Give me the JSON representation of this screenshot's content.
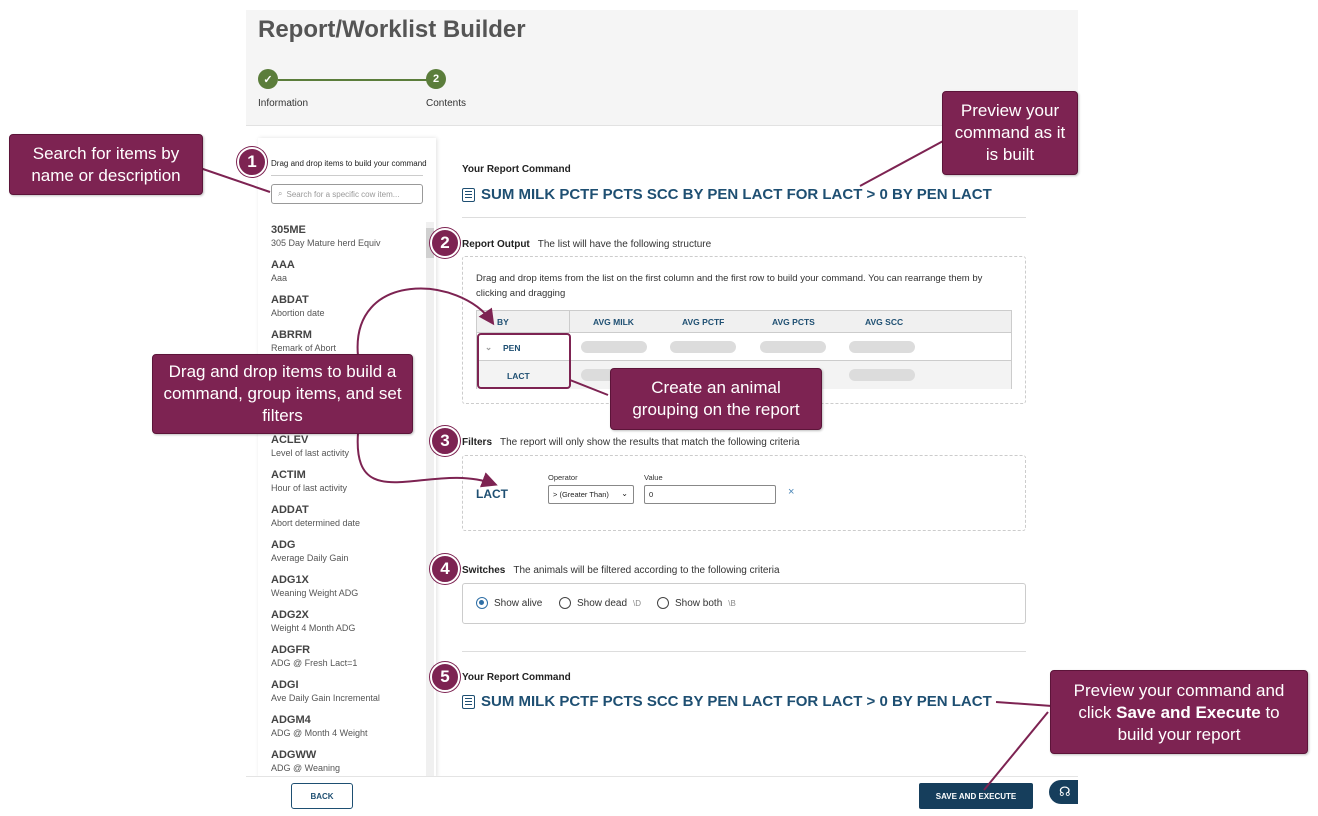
{
  "page": {
    "title": "Report/Worklist Builder",
    "steps": [
      {
        "number": "",
        "icon": "check-icon",
        "label": "Information"
      },
      {
        "number": "2",
        "label": "Contents"
      }
    ]
  },
  "sidebar": {
    "hint": "Drag and drop items to build your command",
    "search_placeholder": "Search for a specific cow item...",
    "items": [
      {
        "code": "305ME",
        "desc": "305 Day Mature herd Equiv"
      },
      {
        "code": "AAA",
        "desc": "Aaa"
      },
      {
        "code": "ABDAT",
        "desc": "Abortion date"
      },
      {
        "code": "ABRRM",
        "desc": "Remark of Abort"
      },
      {
        "code": "",
        "desc": ""
      },
      {
        "code": "",
        "desc": ""
      },
      {
        "code": "ACLEV",
        "desc": "Level of last activity"
      },
      {
        "code": "ACTIM",
        "desc": "Hour of last activity"
      },
      {
        "code": "ADDAT",
        "desc": "Abort determined date"
      },
      {
        "code": "ADG",
        "desc": "Average Daily Gain"
      },
      {
        "code": "ADG1X",
        "desc": "Weaning Weight ADG"
      },
      {
        "code": "ADG2X",
        "desc": "Weight 4 Month ADG"
      },
      {
        "code": "ADGFR",
        "desc": "ADG @ Fresh Lact=1"
      },
      {
        "code": "ADGI",
        "desc": "Ave Daily Gain Incremental"
      },
      {
        "code": "ADGM4",
        "desc": "ADG @ Month 4 Weight"
      },
      {
        "code": "ADGWW",
        "desc": "ADG @ Weaning"
      }
    ]
  },
  "command_top": {
    "title": "Your Report Command",
    "text": "SUM MILK PCTF PCTS SCC BY PEN LACT FOR LACT > 0 BY PEN LACT"
  },
  "report_output": {
    "title": "Report Output",
    "desc": "The list will have the following structure",
    "hint": "Drag and drop items from the list on the first column and the first row to build your command. You can rearrange them by clicking and dragging",
    "columns": [
      "BY",
      "AVG MILK",
      "AVG PCTF",
      "AVG PCTS",
      "AVG SCC"
    ],
    "rows": [
      "PEN",
      "LACT"
    ]
  },
  "filters": {
    "title": "Filters",
    "desc": "The report will only show the results that match the following criteria",
    "item": "LACT",
    "operator_label": "Operator",
    "operator_value": "> (Greater Than)",
    "value_label": "Value",
    "value": "0",
    "remove": "×"
  },
  "switches": {
    "title": "Switches",
    "desc": "The animals will be filtered according to the following criteria",
    "options": [
      {
        "label": "Show alive",
        "shortcut": "",
        "selected": true
      },
      {
        "label": "Show dead",
        "shortcut": "\\D",
        "selected": false
      },
      {
        "label": "Show both",
        "shortcut": "\\B",
        "selected": false
      }
    ]
  },
  "command_bottom": {
    "title": "Your Report Command",
    "text": "SUM MILK PCTF PCTS SCC BY PEN LACT FOR LACT > 0 BY PEN LACT"
  },
  "footer": {
    "back": "BACK",
    "save": "SAVE AND EXECUTE",
    "help_icon": "headset-icon"
  },
  "callouts": {
    "search": "Search for items by name or description",
    "preview": "Preview your command as it is built",
    "drag": "Drag and drop items to build a command, group items, and set filters",
    "group": "Create an animal grouping on the report",
    "save_pre": "Preview your command and click ",
    "save_bold": "Save and Execute",
    "save_post": " to build your report"
  },
  "step_numbers": [
    "1",
    "2",
    "3",
    "4",
    "5"
  ],
  "colors": {
    "callout": "#7d2352",
    "primary": "#1e4f72",
    "step": "#5b7d3b"
  }
}
